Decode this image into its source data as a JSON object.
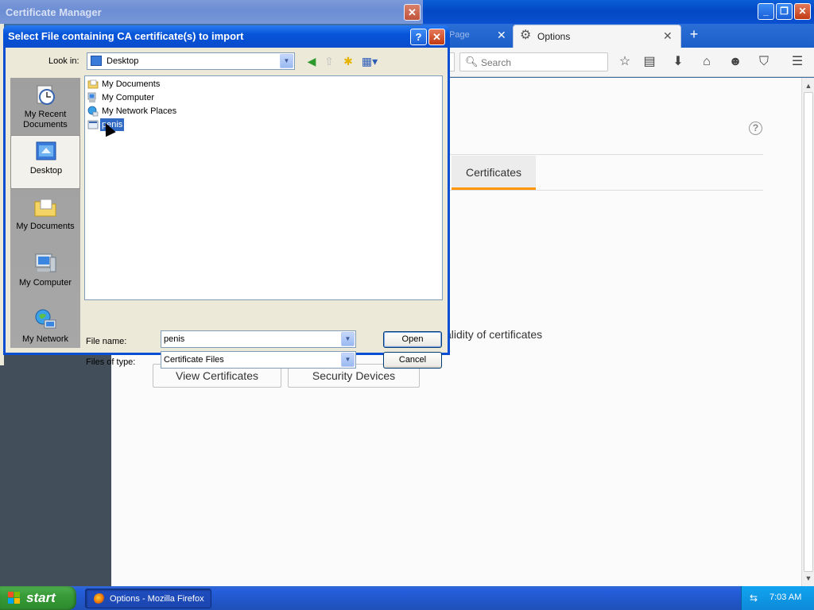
{
  "firefox": {
    "tabs": [
      {
        "label": "Page",
        "active": false
      },
      {
        "label": "Options",
        "active": true
      }
    ],
    "new_tab": "+",
    "search": {
      "placeholder": "Search"
    },
    "preferences": {
      "selected_tab": "Certificates",
      "validity_text": "alidity of certificates",
      "view_certificates": "View Certificates",
      "security_devices": "Security Devices"
    }
  },
  "cert_manager": {
    "title": "Certificate Manager"
  },
  "dialog": {
    "title": "Select File containing CA certificate(s) to import",
    "help_glyph": "?",
    "look_in_label": "Look in:",
    "look_in_value": "Desktop",
    "places": [
      {
        "label": "My Recent Documents",
        "icon": "clock-documents-icon",
        "selected": false
      },
      {
        "label": "Desktop",
        "icon": "desktop-icon",
        "selected": true
      },
      {
        "label": "My Documents",
        "icon": "folder-icon",
        "selected": false
      },
      {
        "label": "My Computer",
        "icon": "computer-icon",
        "selected": false
      },
      {
        "label": "My Network",
        "icon": "network-globe-icon",
        "selected": false
      }
    ],
    "files": [
      {
        "name": "My Documents",
        "icon": "folder-icon",
        "selected": false
      },
      {
        "name": "My Computer",
        "icon": "computer-icon",
        "selected": false
      },
      {
        "name": "My Network Places",
        "icon": "network-icon",
        "selected": false
      },
      {
        "name": "penis",
        "icon": "file-icon",
        "selected": true
      }
    ],
    "file_name_label": "File name:",
    "file_name_value": "penis",
    "file_type_label": "Files of type:",
    "file_type_value": "Certificate Files",
    "open_button": "Open",
    "cancel_button": "Cancel"
  },
  "taskbar": {
    "start_label": "start",
    "task_label": "Options - Mozilla Firefox",
    "clock": "7:03 AM"
  },
  "colors": {
    "accent_orange": "#ff9500",
    "xp_blue": "#0a4fd3",
    "dialog_bg": "#ece9d8",
    "selection": "#316ac5"
  }
}
